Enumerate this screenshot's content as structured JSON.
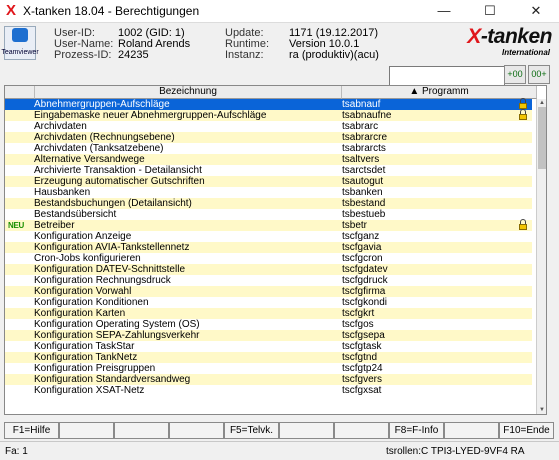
{
  "window": {
    "title": "X-tanken 18.04 - Berechtigungen",
    "app_icon": "X",
    "controls": {
      "minimize": "—",
      "maximize": "☐",
      "close": "✕"
    }
  },
  "teamviewer": {
    "label": "Teamviewer",
    "icon": "teamviewer-icon"
  },
  "header": {
    "user_id_label": "User-ID:",
    "user_id": "1002 (GID: 1)",
    "user_name_label": "User-Name:",
    "user_name": "Roland Arends",
    "process_id_label": "Prozess-ID:",
    "process_id": "24235",
    "update_label": "Update:",
    "update": "1171 (19.12.2017)",
    "runtime_label": "Runtime:",
    "runtime": "Version 10.0.1",
    "instance_label": "Instanz:",
    "instance": "ra (produktiv)(acu)"
  },
  "brand": {
    "main_x": "X",
    "main_rest": "-tanken",
    "sub": "International",
    "accent": "#e0161b"
  },
  "search": {
    "value": "",
    "buttons": [
      "+00",
      "00+"
    ]
  },
  "table": {
    "columns": {
      "name": "Bezeichnung",
      "program": "▲ Programm"
    },
    "rows": [
      {
        "name": "Abnehmergruppen-Aufschläge",
        "program": "tsabnauf",
        "lock": true,
        "selected": true
      },
      {
        "name": "Eingabemaske neuer Abnehmergruppen-Aufschläge",
        "program": "tsabnaufne",
        "lock": true
      },
      {
        "name": "Archivdaten",
        "program": "tsabrarc"
      },
      {
        "name": "Archivdaten (Rechnungsebene)",
        "program": "tsabrarcre"
      },
      {
        "name": "Archivdaten (Tanksatzebene)",
        "program": "tsabrarcts"
      },
      {
        "name": "Alternative Versandwege",
        "program": "tsaltvers"
      },
      {
        "name": "Archivierte Transaktion - Detailansicht",
        "program": "tsarctsdet"
      },
      {
        "name": "Erzeugung automatischer Gutschriften",
        "program": "tsautogut"
      },
      {
        "name": "Hausbanken",
        "program": "tsbanken"
      },
      {
        "name": "Bestandsbuchungen (Detailansicht)",
        "program": "tsbestand"
      },
      {
        "name": "Bestandsübersicht",
        "program": "tsbestueb"
      },
      {
        "name": "Betreiber",
        "program": "tsbetr",
        "lock": true,
        "new": "NEU"
      },
      {
        "name": "Konfiguration Anzeige",
        "program": "tscfganz"
      },
      {
        "name": "Konfiguration AVIA-Tankstellennetz",
        "program": "tscfgavia"
      },
      {
        "name": "Cron-Jobs konfigurieren",
        "program": "tscfgcron"
      },
      {
        "name": "Konfiguration DATEV-Schnittstelle",
        "program": "tscfgdatev"
      },
      {
        "name": "Konfiguration Rechnungsdruck",
        "program": "tscfgdruck"
      },
      {
        "name": "Konfiguration Vorwahl",
        "program": "tscfgfirma"
      },
      {
        "name": "Konfiguration Konditionen",
        "program": "tscfgkondi"
      },
      {
        "name": "Konfiguration Karten",
        "program": "tscfgkrt"
      },
      {
        "name": "Konfiguration Operating System (OS)",
        "program": "tscfgos"
      },
      {
        "name": "Konfiguration SEPA-Zahlungsverkehr",
        "program": "tscfgsepa"
      },
      {
        "name": "Konfiguration TaskStar",
        "program": "tscfgtask"
      },
      {
        "name": "Konfiguration TankNetz",
        "program": "tscfgtnd"
      },
      {
        "name": "Konfiguration Preisgruppen",
        "program": "tscfgtp24"
      },
      {
        "name": "Konfiguration Standardversandweg",
        "program": "tscfgvers"
      },
      {
        "name": "Konfiguration XSAT-Netz",
        "program": "tscfgxsat"
      }
    ]
  },
  "fkeys": [
    "F1=Hilfe",
    "",
    "",
    "",
    "F5=Telvk.",
    "",
    "",
    "F8=F-Info",
    "",
    "F10=Ende"
  ],
  "status": {
    "left": "Fa: 1",
    "right": "tsrollen:C TPI3-LYED-9VF4 RA"
  }
}
